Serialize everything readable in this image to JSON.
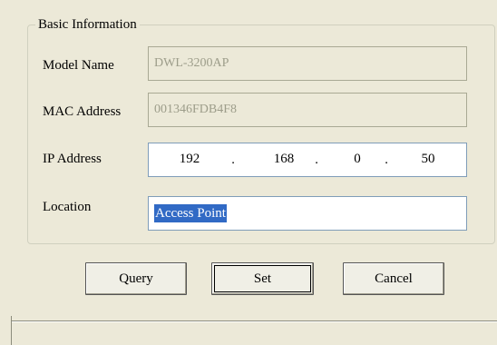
{
  "group": {
    "title": "Basic Information"
  },
  "fields": {
    "model_name": {
      "label": "Model Name",
      "value": "DWL-3200AP"
    },
    "mac_address": {
      "label": "MAC Address",
      "value": "001346FDB4F8"
    },
    "ip_address": {
      "label": "IP Address",
      "octets": [
        "192",
        "168",
        "0",
        "50"
      ],
      "separator": "."
    },
    "location": {
      "label": "Location",
      "value": "Access Point"
    }
  },
  "buttons": {
    "query": "Query",
    "set": "Set",
    "cancel": "Cancel"
  }
}
